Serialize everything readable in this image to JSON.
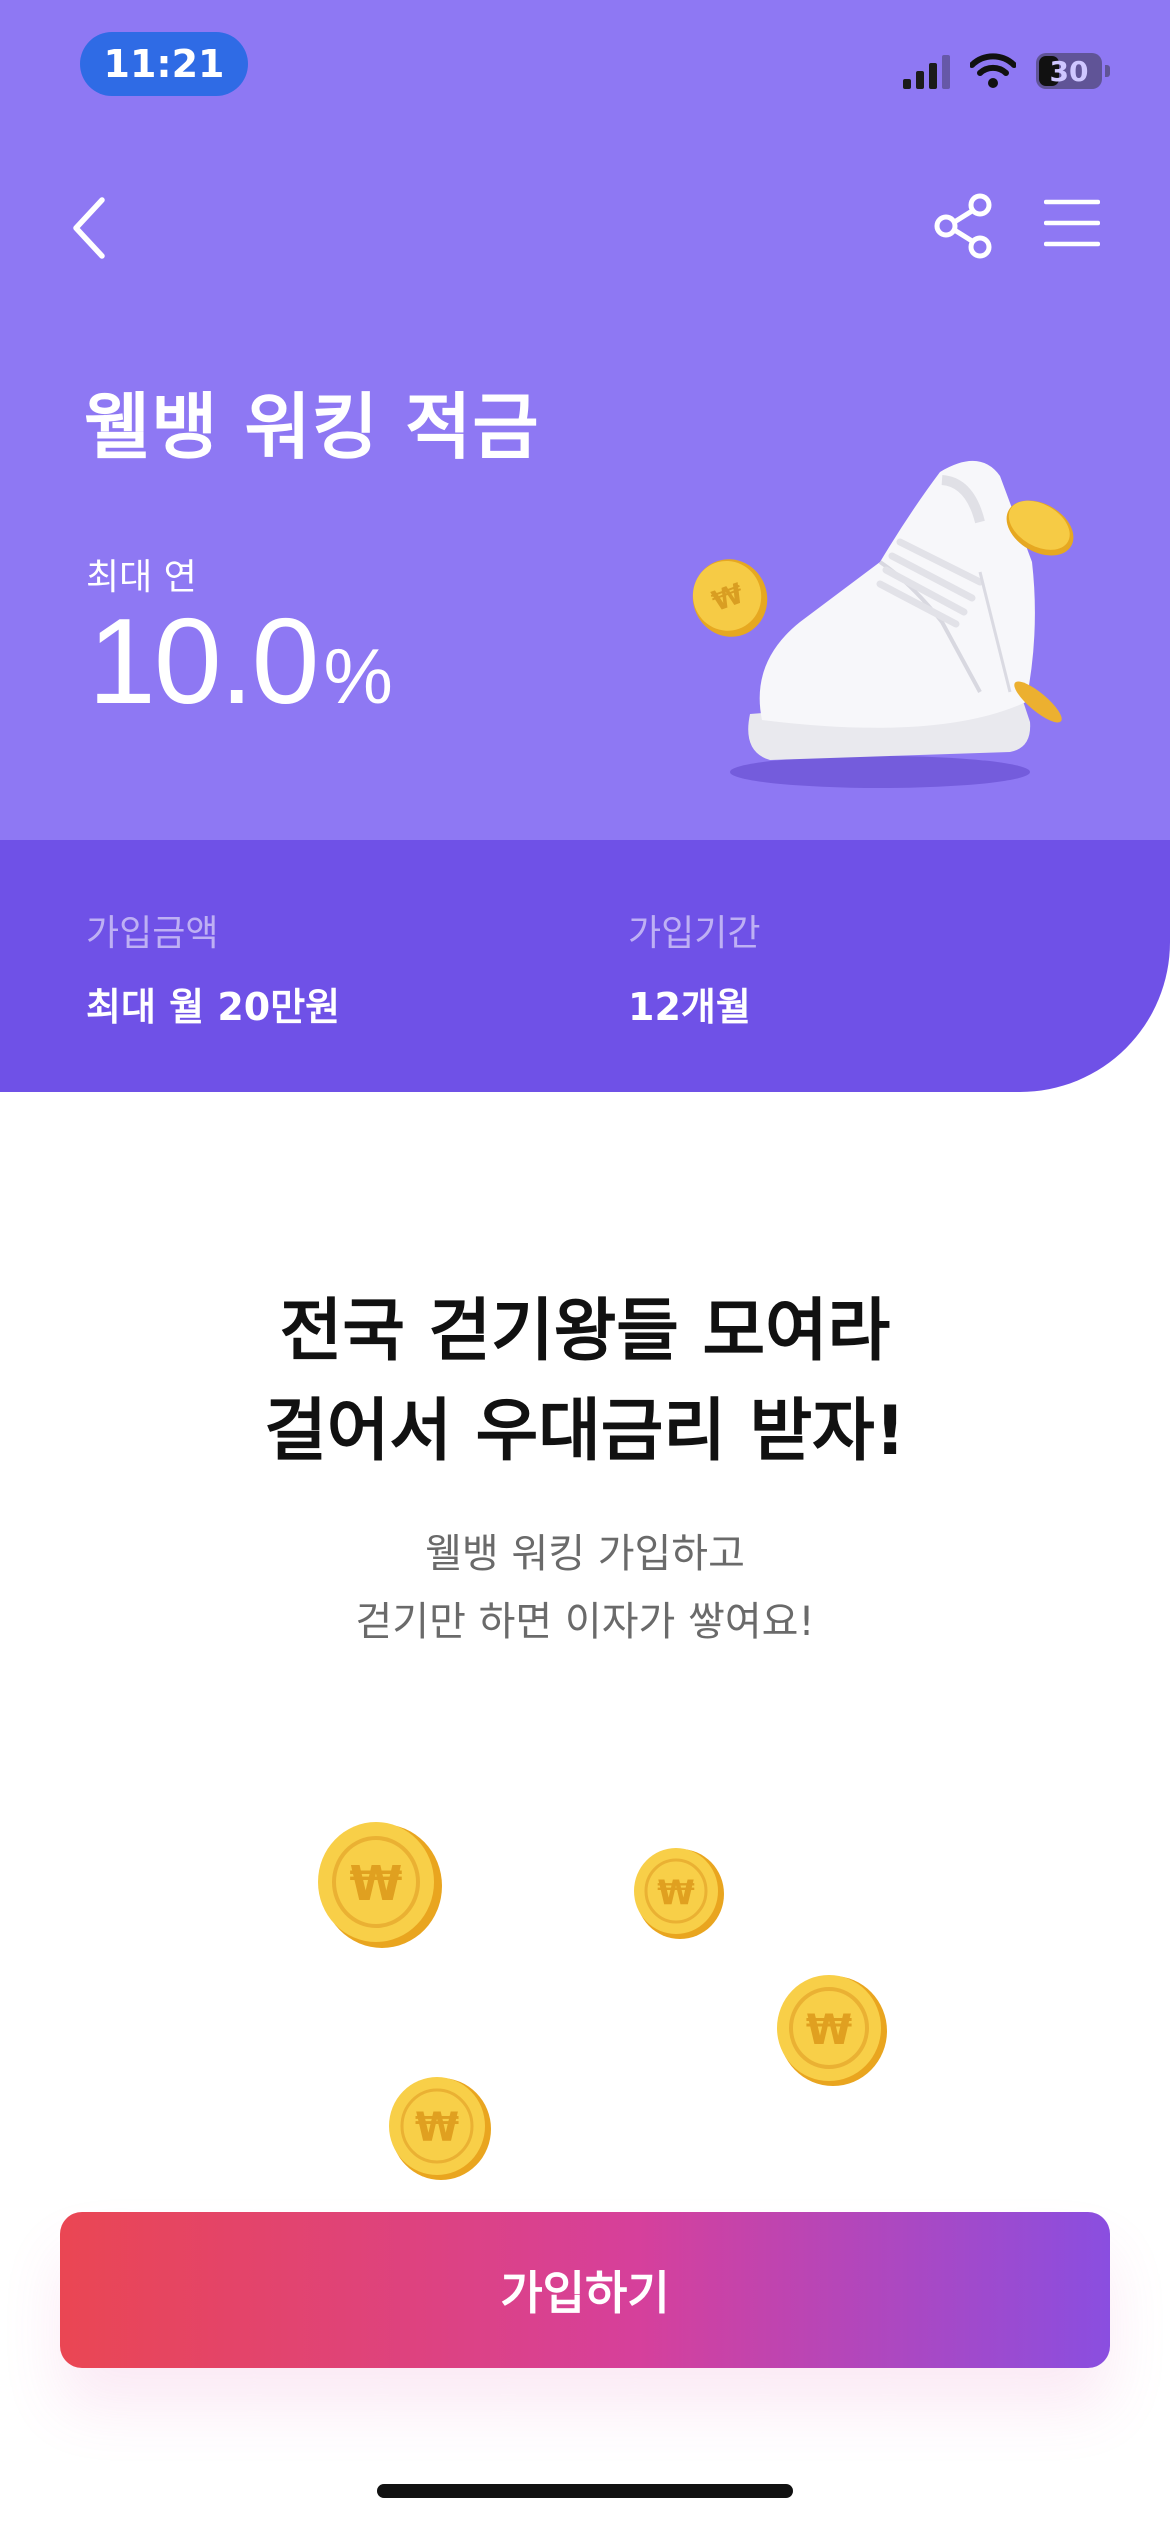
{
  "status_bar": {
    "time": "11:21",
    "battery": "30"
  },
  "nav": {
    "back_icon": "chevron-left-icon",
    "share_icon": "share-icon",
    "menu_icon": "hamburger-menu-icon"
  },
  "hero": {
    "title": "웰뱅 워킹 적금",
    "rate_label": "최대 연",
    "rate_value": "10.0",
    "rate_unit": "%",
    "illustration": "sneaker-with-coins"
  },
  "info": {
    "amount_label": "가입금액",
    "amount_value": "최대 월 20만원",
    "period_label": "가입기간",
    "period_value": "12개월"
  },
  "promo": {
    "headline_line1": "전국 걷기왕들 모여라",
    "headline_line2": "걸어서 우대금리 받자!",
    "sub_line1": "웰뱅 워킹 가입하고",
    "sub_line2": "걷기만 하면 이자가 쌓여요!"
  },
  "cta": {
    "label": "가입하기"
  },
  "colors": {
    "hero_bg": "#8e78f3",
    "info_bg": "#6f51e7",
    "cta_gradient_start": "#ea4653",
    "cta_gradient_end": "#8a4ee0",
    "coin": "#f4c437"
  }
}
